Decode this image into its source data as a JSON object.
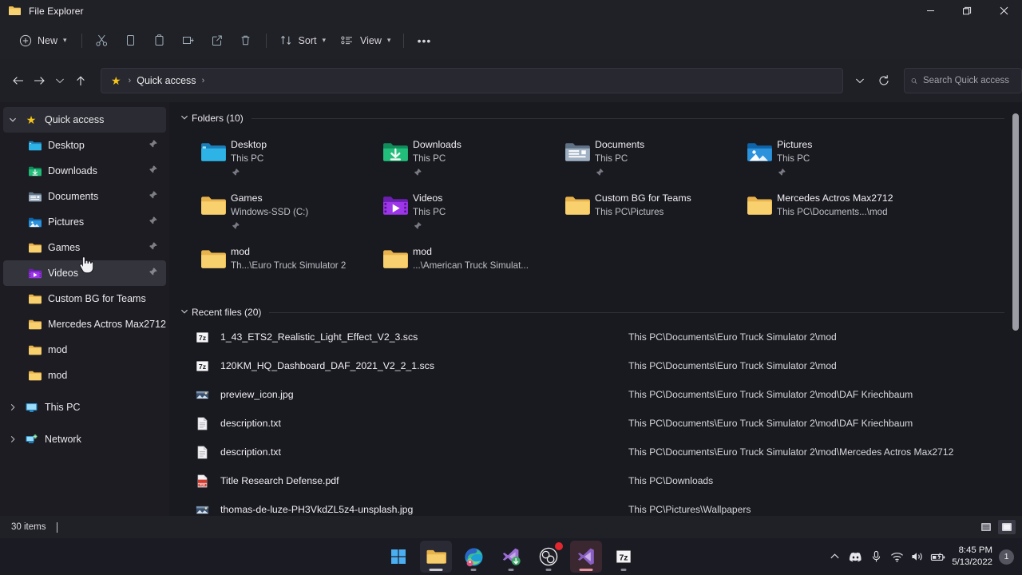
{
  "window": {
    "title": "File Explorer",
    "icon": "folder-icon",
    "minimize_label": "Minimize",
    "maximize_label": "Restore",
    "close_label": "Close"
  },
  "toolbar": {
    "new_label": "New",
    "items": [
      {
        "name": "cut-button",
        "icon": "scissors-icon"
      },
      {
        "name": "copy-button",
        "icon": "copy-icon"
      },
      {
        "name": "paste-button",
        "icon": "paste-icon"
      },
      {
        "name": "rename-button",
        "icon": "rename-icon"
      },
      {
        "name": "share-button",
        "icon": "share-icon"
      },
      {
        "name": "delete-button",
        "icon": "trash-icon"
      }
    ],
    "sort_label": "Sort",
    "view_label": "View",
    "more_label": "•••"
  },
  "addressbar": {
    "back_label": "←",
    "forward_label": "→",
    "recent_label": "⌄",
    "up_label": "↑",
    "breadcrumb_icon": "star-icon",
    "breadcrumb": "Quick access",
    "breadcrumb_sep_left": "›",
    "breadcrumb_sep_right": "›",
    "dropdown_label": "⌄",
    "refresh_label": "⟳"
  },
  "search": {
    "placeholder": "Search Quick access",
    "value": "",
    "icon": "search-icon"
  },
  "sidebar": {
    "root": {
      "label": "Quick access",
      "icon": "star-icon",
      "expanded": true
    },
    "items": [
      {
        "label": "Desktop",
        "icon": "desktop-folder-icon",
        "pinned": true
      },
      {
        "label": "Downloads",
        "icon": "downloads-icon",
        "pinned": true
      },
      {
        "label": "Documents",
        "icon": "documents-icon",
        "pinned": true
      },
      {
        "label": "Pictures",
        "icon": "pictures-icon",
        "pinned": true
      },
      {
        "label": "Games",
        "icon": "folder-icon",
        "pinned": true
      },
      {
        "label": "Videos",
        "icon": "videos-icon",
        "pinned": true,
        "hovered": true
      },
      {
        "label": "Custom BG for Teams",
        "icon": "folder-icon",
        "pinned": false
      },
      {
        "label": "Mercedes Actros Max2712",
        "icon": "folder-icon",
        "pinned": false
      },
      {
        "label": "mod",
        "icon": "folder-icon",
        "pinned": false
      },
      {
        "label": "mod",
        "icon": "folder-icon",
        "pinned": false
      }
    ],
    "roots": [
      {
        "label": "This PC",
        "icon": "pc-icon"
      },
      {
        "label": "Network",
        "icon": "network-icon"
      }
    ]
  },
  "main": {
    "folders_header": "Folders (10)",
    "recent_header": "Recent files (20)",
    "folders": [
      {
        "name": "Desktop",
        "sub": "This PC",
        "icon": "desktop-folder-icon",
        "pinned": true
      },
      {
        "name": "Downloads",
        "sub": "This PC",
        "icon": "downloads-icon",
        "pinned": true
      },
      {
        "name": "Documents",
        "sub": "This PC",
        "icon": "documents-icon",
        "pinned": true
      },
      {
        "name": "Pictures",
        "sub": "This PC",
        "icon": "pictures-icon",
        "pinned": true
      },
      {
        "name": "Games",
        "sub": "Windows-SSD (C:)",
        "icon": "folder-icon",
        "pinned": true
      },
      {
        "name": "Videos",
        "sub": "This PC",
        "icon": "videos-icon",
        "pinned": true
      },
      {
        "name": "Custom BG for Teams",
        "sub": "This PC\\Pictures",
        "icon": "folder-icon",
        "pinned": false
      },
      {
        "name": "Mercedes Actros Max2712",
        "sub": "This PC\\Documents...\\mod",
        "icon": "folder-icon",
        "pinned": false
      },
      {
        "name": "mod",
        "sub": "Th...\\Euro Truck Simulator 2",
        "icon": "folder-icon",
        "pinned": false
      },
      {
        "name": "mod",
        "sub": "...\\American Truck Simulat...",
        "icon": "folder-icon",
        "pinned": false
      }
    ],
    "recent_files": [
      {
        "name": "1_43_ETS2_Realistic_Light_Effect_V2_3.scs",
        "path": "This PC\\Documents\\Euro Truck Simulator 2\\mod",
        "icon": "7z-icon"
      },
      {
        "name": "120KM_HQ_Dashboard_DAF_2021_V2_2_1.scs",
        "path": "This PC\\Documents\\Euro Truck Simulator 2\\mod",
        "icon": "7z-icon"
      },
      {
        "name": "preview_icon.jpg",
        "path": "This PC\\Documents\\Euro Truck Simulator 2\\mod\\DAF Kriechbaum",
        "icon": "image-icon"
      },
      {
        "name": "description.txt",
        "path": "This PC\\Documents\\Euro Truck Simulator 2\\mod\\DAF Kriechbaum",
        "icon": "text-icon"
      },
      {
        "name": "description.txt",
        "path": "This PC\\Documents\\Euro Truck Simulator 2\\mod\\Mercedes Actros Max2712",
        "icon": "text-icon"
      },
      {
        "name": "Title Research Defense.pdf",
        "path": "This PC\\Downloads",
        "icon": "pdf-icon"
      },
      {
        "name": "thomas-de-luze-PH3VkdZL5z4-unsplash.jpg",
        "path": "This PC\\Pictures\\Wallpapers",
        "icon": "image-icon"
      }
    ]
  },
  "statusbar": {
    "items_text": "30 items",
    "view_details_label": "Details view",
    "view_icons_label": "Large icons view"
  },
  "taskbar": {
    "apps": [
      {
        "name": "start-button",
        "icon": "windows-icon"
      },
      {
        "name": "file-explorer",
        "icon": "folder-icon"
      },
      {
        "name": "microsoft-edge",
        "icon": "edge-icon"
      },
      {
        "name": "vs-code-installer",
        "icon": "vscode-installer-icon"
      },
      {
        "name": "obs-studio",
        "icon": "obs-icon",
        "badge": true
      },
      {
        "name": "visual-studio",
        "icon": "visual-studio-icon"
      },
      {
        "name": "7-zip",
        "icon": "7z-icon"
      }
    ],
    "tray": [
      {
        "name": "show-hidden-icons",
        "icon": "chevron-up-icon"
      },
      {
        "name": "discord-tray",
        "icon": "discord-icon"
      },
      {
        "name": "microphone-tray",
        "icon": "microphone-icon"
      },
      {
        "name": "network-tray",
        "icon": "wifi-icon"
      },
      {
        "name": "volume-tray",
        "icon": "speaker-icon"
      },
      {
        "name": "battery-tray",
        "icon": "battery-icon"
      }
    ],
    "time": "8:45 PM",
    "date": "5/13/2022",
    "notification_count": "1"
  },
  "colors": {
    "titlebar": "#202027",
    "content_bg": "#191920",
    "sidebar_bg": "#1c1c22",
    "accent_star": "#f5c518",
    "folder_yellow": "#f2c14e",
    "hover": "#34343d"
  }
}
